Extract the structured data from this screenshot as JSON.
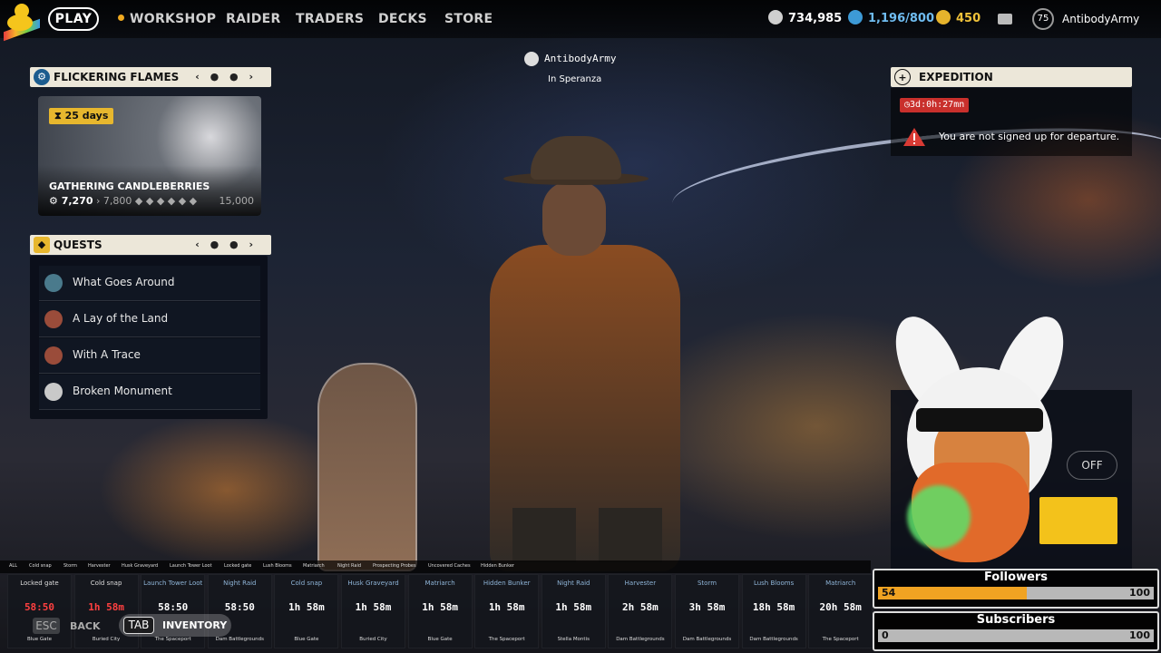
{
  "topbar": {
    "play_label": "PLAY",
    "nav": [
      "WORKSHOP",
      "RAIDER",
      "TRADERS",
      "DECKS",
      "STORE"
    ],
    "coins": "734,985",
    "tokens": "1,196/800",
    "raider_points": "450",
    "level": "75",
    "username": "AntibodyArmy"
  },
  "center": {
    "name": "AntibodyArmy",
    "location": "In Speranza"
  },
  "event_panel": {
    "title": "FLICKERING FLAMES",
    "days": "25 days",
    "event_name": "GATHERING CANDLEBERRIES",
    "progress_current": "7,270",
    "progress_next": "7,800",
    "progress_max": "15,000"
  },
  "quests_panel": {
    "title": "QUESTS",
    "items": [
      {
        "label": "What Goes Around"
      },
      {
        "label": "A Lay of the Land"
      },
      {
        "label": "With A Trace"
      },
      {
        "label": "Broken Monument"
      }
    ]
  },
  "expedition": {
    "title": "EXPEDITION",
    "timer": "3d:0h:27mn",
    "warning": "You are not signed up for departure."
  },
  "side_panel": {
    "toggle": "OFF"
  },
  "tracker": {
    "tabs": [
      "ALL",
      "Cold snap",
      "Storm",
      "Harvester",
      "Husk Graveyard",
      "Launch Tower Loot",
      "Locked gate",
      "Lush Blooms",
      "Matriarch",
      "Night Raid",
      "Prospecting Probes",
      "Uncovered Caches",
      "Hidden Bunker"
    ],
    "cards": [
      {
        "name": "Locked gate",
        "time": "58:50",
        "location": "Blue Gate",
        "red": true
      },
      {
        "name": "Cold snap",
        "time": "1h 58m",
        "location": "Buried City",
        "red": true
      },
      {
        "name": "Launch Tower Loot",
        "time": "58:50",
        "location": "The Spaceport",
        "red": false
      },
      {
        "name": "Night Raid",
        "time": "58:50",
        "location": "Dam Battlegrounds",
        "red": false
      },
      {
        "name": "Cold snap",
        "time": "1h 58m",
        "location": "Blue Gate",
        "red": false
      },
      {
        "name": "Husk Graveyard",
        "time": "1h 58m",
        "location": "Buried City",
        "red": false
      },
      {
        "name": "Matriarch",
        "time": "1h 58m",
        "location": "Blue Gate",
        "red": false
      },
      {
        "name": "Hidden Bunker",
        "time": "1h 58m",
        "location": "The Spaceport",
        "red": false
      },
      {
        "name": "Night Raid",
        "time": "1h 58m",
        "location": "Stella Montis",
        "red": false
      },
      {
        "name": "Harvester",
        "time": "2h 58m",
        "location": "Dam Battlegrounds",
        "red": false
      },
      {
        "name": "Storm",
        "time": "3h 58m",
        "location": "Dam Battlegrounds",
        "red": false
      },
      {
        "name": "Lush Blooms",
        "time": "18h 58m",
        "location": "Dam Battlegrounds",
        "red": false
      },
      {
        "name": "Matriarch",
        "time": "20h 58m",
        "location": "The Spaceport",
        "red": false
      }
    ]
  },
  "controls": {
    "esc": "ESC",
    "back": "BACK",
    "tab": "TAB",
    "inventory": "INVENTORY"
  },
  "followers": {
    "title": "Followers",
    "current": "54",
    "max": "100",
    "fraction": 0.54
  },
  "subscribers": {
    "title": "Subscribers",
    "current": "0",
    "max": "100",
    "fraction": 0.0
  }
}
